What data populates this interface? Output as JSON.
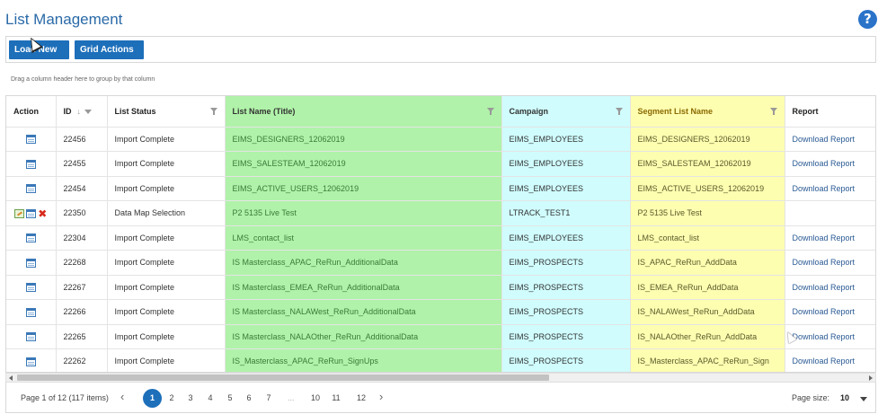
{
  "page": {
    "title": "List Management",
    "help_icon": "help-icon"
  },
  "toolbar": {
    "load_label": "Load New List",
    "grid_actions_label": "Grid Actions"
  },
  "group_hint": "Drag a column header here to group by that column",
  "columns": {
    "action": "Action",
    "id": "ID",
    "status": "List Status",
    "list_name": "List Name (Title)",
    "campaign": "Campaign",
    "segment": "Segment List Name",
    "report": "Report"
  },
  "colors": {
    "list_col": "#b0f2a9",
    "campaign_col": "#d0fcfd",
    "segment_col": "#fefeb1",
    "accent": "#1d6fba"
  },
  "rows": [
    {
      "actions": [
        "grid-icon"
      ],
      "id": "22456",
      "status": "Import Complete",
      "list_name": "EIMS_DESIGNERS_12062019",
      "campaign": "EIMS_EMPLOYEES",
      "segment": "EIMS_DESIGNERS_12062019",
      "report": "Download Report"
    },
    {
      "actions": [
        "grid-icon"
      ],
      "id": "22455",
      "status": "Import Complete",
      "list_name": "EIMS_SALESTEAM_12062019",
      "campaign": "EIMS_EMPLOYEES",
      "segment": "EIMS_SALESTEAM_12062019",
      "report": "Download Report"
    },
    {
      "actions": [
        "grid-icon"
      ],
      "id": "22454",
      "status": "Import Complete",
      "list_name": "EIMS_ACTIVE_USERS_12062019",
      "campaign": "EIMS_EMPLOYEES",
      "segment": "EIMS_ACTIVE_USERS_12062019",
      "report": "Download Report"
    },
    {
      "actions": [
        "edit-icon",
        "grid-icon",
        "delete-icon"
      ],
      "id": "22350",
      "status": "Data Map Selection",
      "list_name": "P2 5135 Live Test",
      "campaign": "LTRACK_TEST1",
      "segment": "P2 5135 Live Test",
      "report": ""
    },
    {
      "actions": [
        "grid-icon"
      ],
      "id": "22304",
      "status": "Import Complete",
      "list_name": "LMS_contact_list",
      "campaign": "EIMS_EMPLOYEES",
      "segment": "LMS_contact_list",
      "report": "Download Report"
    },
    {
      "actions": [
        "grid-icon"
      ],
      "id": "22268",
      "status": "Import Complete",
      "list_name": "IS Masterclass_APAC_ReRun_AdditionalData",
      "campaign": "EIMS_PROSPECTS",
      "segment": "IS_APAC_ReRun_AddData",
      "report": "Download Report"
    },
    {
      "actions": [
        "grid-icon"
      ],
      "id": "22267",
      "status": "Import Complete",
      "list_name": "IS Masterclass_EMEA_ReRun_AdditionalData",
      "campaign": "EIMS_PROSPECTS",
      "segment": "IS_EMEA_ReRun_AddData",
      "report": "Download Report"
    },
    {
      "actions": [
        "grid-icon"
      ],
      "id": "22266",
      "status": "Import Complete",
      "list_name": "IS Masterclass_NALAWest_ReRun_AdditionalData",
      "campaign": "EIMS_PROSPECTS",
      "segment": "IS_NALAWest_ReRun_AddData",
      "report": "Download Report"
    },
    {
      "actions": [
        "grid-icon"
      ],
      "id": "22265",
      "status": "Import Complete",
      "list_name": "IS Masterclass_NALAOther_ReRun_AdditionalData",
      "campaign": "EIMS_PROSPECTS",
      "segment": "IS_NALAOther_ReRun_AddData",
      "report": "Download Report"
    },
    {
      "actions": [
        "grid-icon"
      ],
      "id": "22262",
      "status": "Import Complete",
      "list_name": "IS_Masterclass_APAC_ReRun_SignUps",
      "campaign": "EIMS_PROSPECTS",
      "segment": "IS_Masterclass_APAC_ReRun_Sign",
      "report": "Download Report"
    }
  ],
  "pager": {
    "info": "Page 1 of 12 (117 items)",
    "pages": [
      "1",
      "2",
      "3",
      "4",
      "5",
      "6",
      "7"
    ],
    "ellipsis": "...",
    "tail_pages": [
      "10",
      "11",
      "12"
    ],
    "current": "1",
    "page_size_label": "Page size:",
    "page_size_value": "10"
  }
}
